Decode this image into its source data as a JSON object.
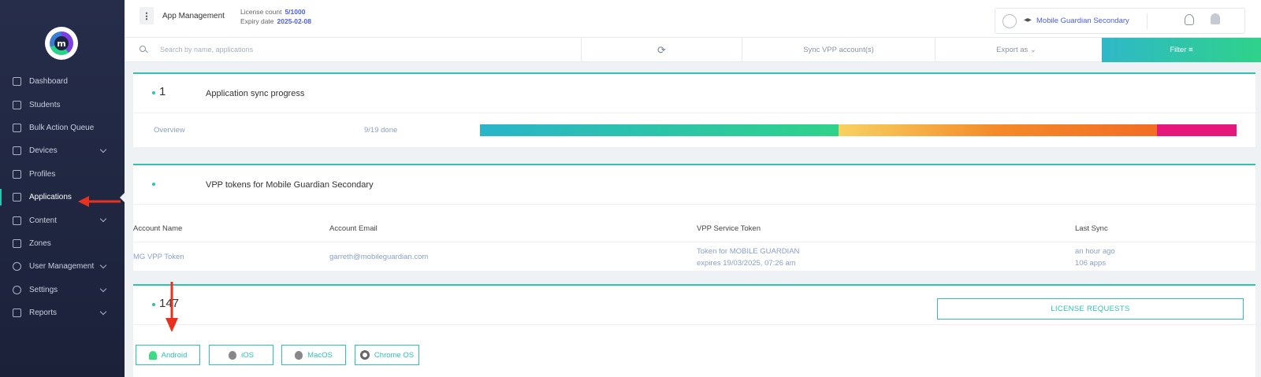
{
  "sidebar": {
    "logo_letter": "m",
    "items": [
      {
        "label": "Dashboard"
      },
      {
        "label": "Students"
      },
      {
        "label": "Bulk Action Queue"
      },
      {
        "label": "Devices"
      },
      {
        "label": "Profiles"
      },
      {
        "label": "Applications"
      },
      {
        "label": "Content"
      },
      {
        "label": "Zones"
      },
      {
        "label": "User Management"
      },
      {
        "label": "Settings"
      },
      {
        "label": "Reports"
      }
    ]
  },
  "header": {
    "menu_glyph": "⋮",
    "title": "App Management",
    "license_label": "License count",
    "license_value": "5/1000",
    "expiry_label": "Expiry date",
    "expiry_value": "2025-02-08",
    "org_name": "Mobile Guardian Secondary"
  },
  "toolbar": {
    "search_placeholder": "Search by name, applications",
    "refresh_glyph": "⟳",
    "sync_label": "Sync VPP account(s)",
    "export_label": "Export as ⌄",
    "filter_label": "Filter ≡"
  },
  "sync_card": {
    "count": "1",
    "title": "Application sync progress",
    "overview_label": "Overview",
    "progress_text": "9/19 done",
    "segments": [
      {
        "fraction": 0.474
      },
      {
        "fraction": 0.421
      },
      {
        "fraction": 0.105
      }
    ]
  },
  "vpp_card": {
    "title": "VPP tokens for Mobile Guardian Secondary",
    "columns": [
      "Account Name",
      "Account Email",
      "VPP Service Token",
      "Last Sync"
    ],
    "row": {
      "account_name": "MG VPP Token",
      "account_email": "garreth@mobileguardian.com",
      "token_line1": "Token for MOBILE GUARDIAN",
      "token_line2": "expires 19/03/2025, 07:26 am",
      "last_sync_line1": "an hour ago",
      "last_sync_line2": "106 apps"
    }
  },
  "apps_card": {
    "count": "147",
    "license_button": "LICENSE REQUESTS",
    "os_filters": [
      {
        "label": "Android"
      },
      {
        "label": "iOS"
      },
      {
        "label": "MacOS"
      },
      {
        "label": "Chrome OS"
      }
    ]
  },
  "colors": {
    "accent": "#2fc2b0",
    "link": "#4a5ee6",
    "annotation_arrow": "#e8321f"
  }
}
